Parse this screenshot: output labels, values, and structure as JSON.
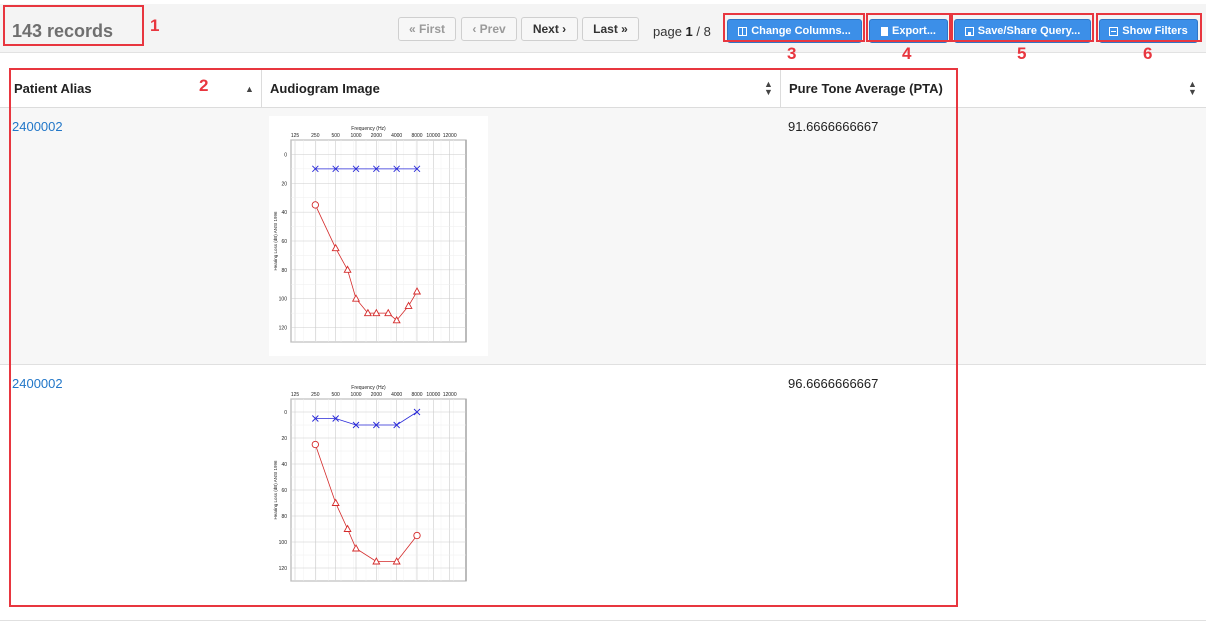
{
  "records": {
    "count_label": "143 records"
  },
  "pager": {
    "first": "« First",
    "prev": "‹ Prev",
    "next": "Next ›",
    "last": "Last »",
    "page_prefix": "page",
    "page_current": "1",
    "page_sep": " / ",
    "page_total": "8"
  },
  "actions": {
    "change_columns": "Change Columns...",
    "export": "Export...",
    "save_share": "Save/Share Query...",
    "show_filters": "Show Filters",
    "color": "#3c8fe8"
  },
  "table": {
    "columns": [
      "Patient Alias",
      "Audiogram Image",
      "Pure Tone Average (PTA)"
    ],
    "rows": [
      {
        "alias": "2400002",
        "pta": "91.6666666667"
      },
      {
        "alias": "2400002",
        "pta": "96.6666666667"
      }
    ]
  },
  "audiogram": {
    "title": "Frequency (Hz)",
    "ylabel": "Hearing Loss (dB) ANSI 1996",
    "x_ticks": [
      "125",
      "250",
      "500",
      "1000",
      "2000",
      "4000",
      "8000",
      "10000",
      "12000"
    ],
    "y_ticks": [
      "0",
      "20",
      "40",
      "60",
      "80",
      "100",
      "120"
    ],
    "series_colors": {
      "right": "#d42a2a",
      "left": "#2828d8"
    }
  },
  "chart_data": [
    {
      "type": "line",
      "xlabel": "Frequency (Hz)",
      "ylabel": "Hearing Loss (dB) ANSI 1996",
      "ylim": [
        -10,
        130
      ],
      "series": [
        {
          "x": [
            250,
            500,
            1000,
            2000,
            4000,
            8000
          ],
          "values": [
            10,
            10,
            10,
            10,
            10,
            10
          ],
          "marker": "x",
          "color": "#2828d8"
        },
        {
          "x": [
            250,
            500,
            750,
            1000,
            1500,
            2000,
            3000,
            4000,
            6000,
            8000
          ],
          "values": [
            35,
            65,
            80,
            100,
            110,
            110,
            110,
            115,
            105,
            95
          ],
          "marker": "circle-then-triangle",
          "color": "#d42a2a"
        }
      ]
    },
    {
      "type": "line",
      "xlabel": "Frequency (Hz)",
      "ylabel": "Hearing Loss (dB) ANSI 1996",
      "ylim": [
        -10,
        130
      ],
      "series": [
        {
          "x": [
            250,
            500,
            1000,
            2000,
            4000,
            8000
          ],
          "values": [
            5,
            5,
            10,
            10,
            10,
            0
          ],
          "marker": "x",
          "color": "#2828d8"
        },
        {
          "x": [
            250,
            500,
            750,
            1000,
            2000,
            4000,
            8000
          ],
          "values": [
            25,
            70,
            90,
            105,
            115,
            115,
            95
          ],
          "marker": "circle-then-triangle",
          "color": "#d42a2a"
        }
      ]
    }
  ],
  "annotations": [
    "1",
    "2",
    "3",
    "4",
    "5",
    "6"
  ]
}
